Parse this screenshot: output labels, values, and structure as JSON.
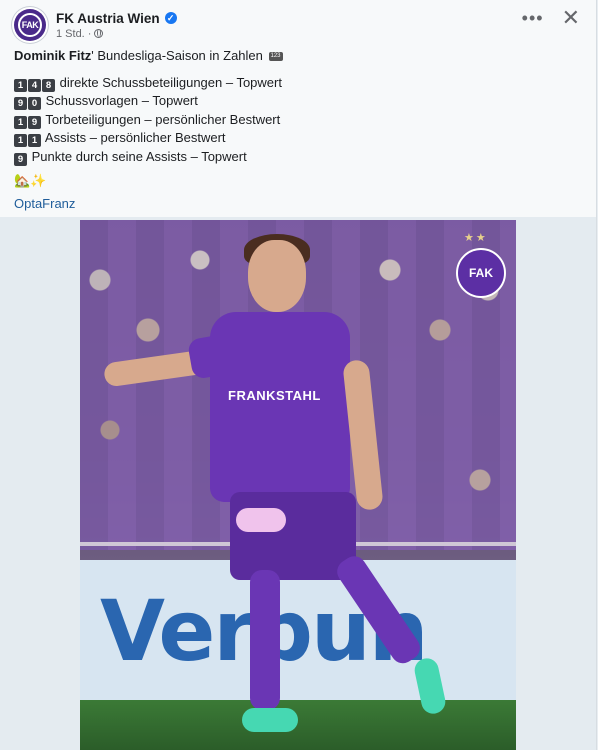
{
  "header": {
    "page_name": "FK Austria Wien",
    "time": "1 Std.",
    "separator": "·",
    "more_label": "•••",
    "close_label": "✕",
    "avatar_text": "FAK"
  },
  "post": {
    "headline_bold": "Dominik Fitz",
    "headline_rest": "' Bundesliga-Saison in Zahlen",
    "headline_badge": "123",
    "stats": [
      {
        "digits": [
          "1",
          "4",
          "8"
        ],
        "text": "direkte Schussbeteiligungen – Topwert"
      },
      {
        "digits": [
          "9",
          "0"
        ],
        "text": "Schussvorlagen – Topwert"
      },
      {
        "digits": [
          "1",
          "9"
        ],
        "text": "Torbeteiligungen – persönlicher Bestwert"
      },
      {
        "digits": [
          "1",
          "1"
        ],
        "text": "Assists – persönlicher Bestwert"
      },
      {
        "digits": [
          "9"
        ],
        "text": "Punkte durch seine Assists – Topwert"
      }
    ],
    "emojis": "🏡✨",
    "tag": "OptaFranz"
  },
  "image": {
    "board_text": "Verbun",
    "shirt_sponsor": "FRANKSTAHL",
    "crest_text": "FAK",
    "stars": "★★"
  },
  "colors": {
    "accent": "#1877f2",
    "violet": "#6a36b4"
  }
}
